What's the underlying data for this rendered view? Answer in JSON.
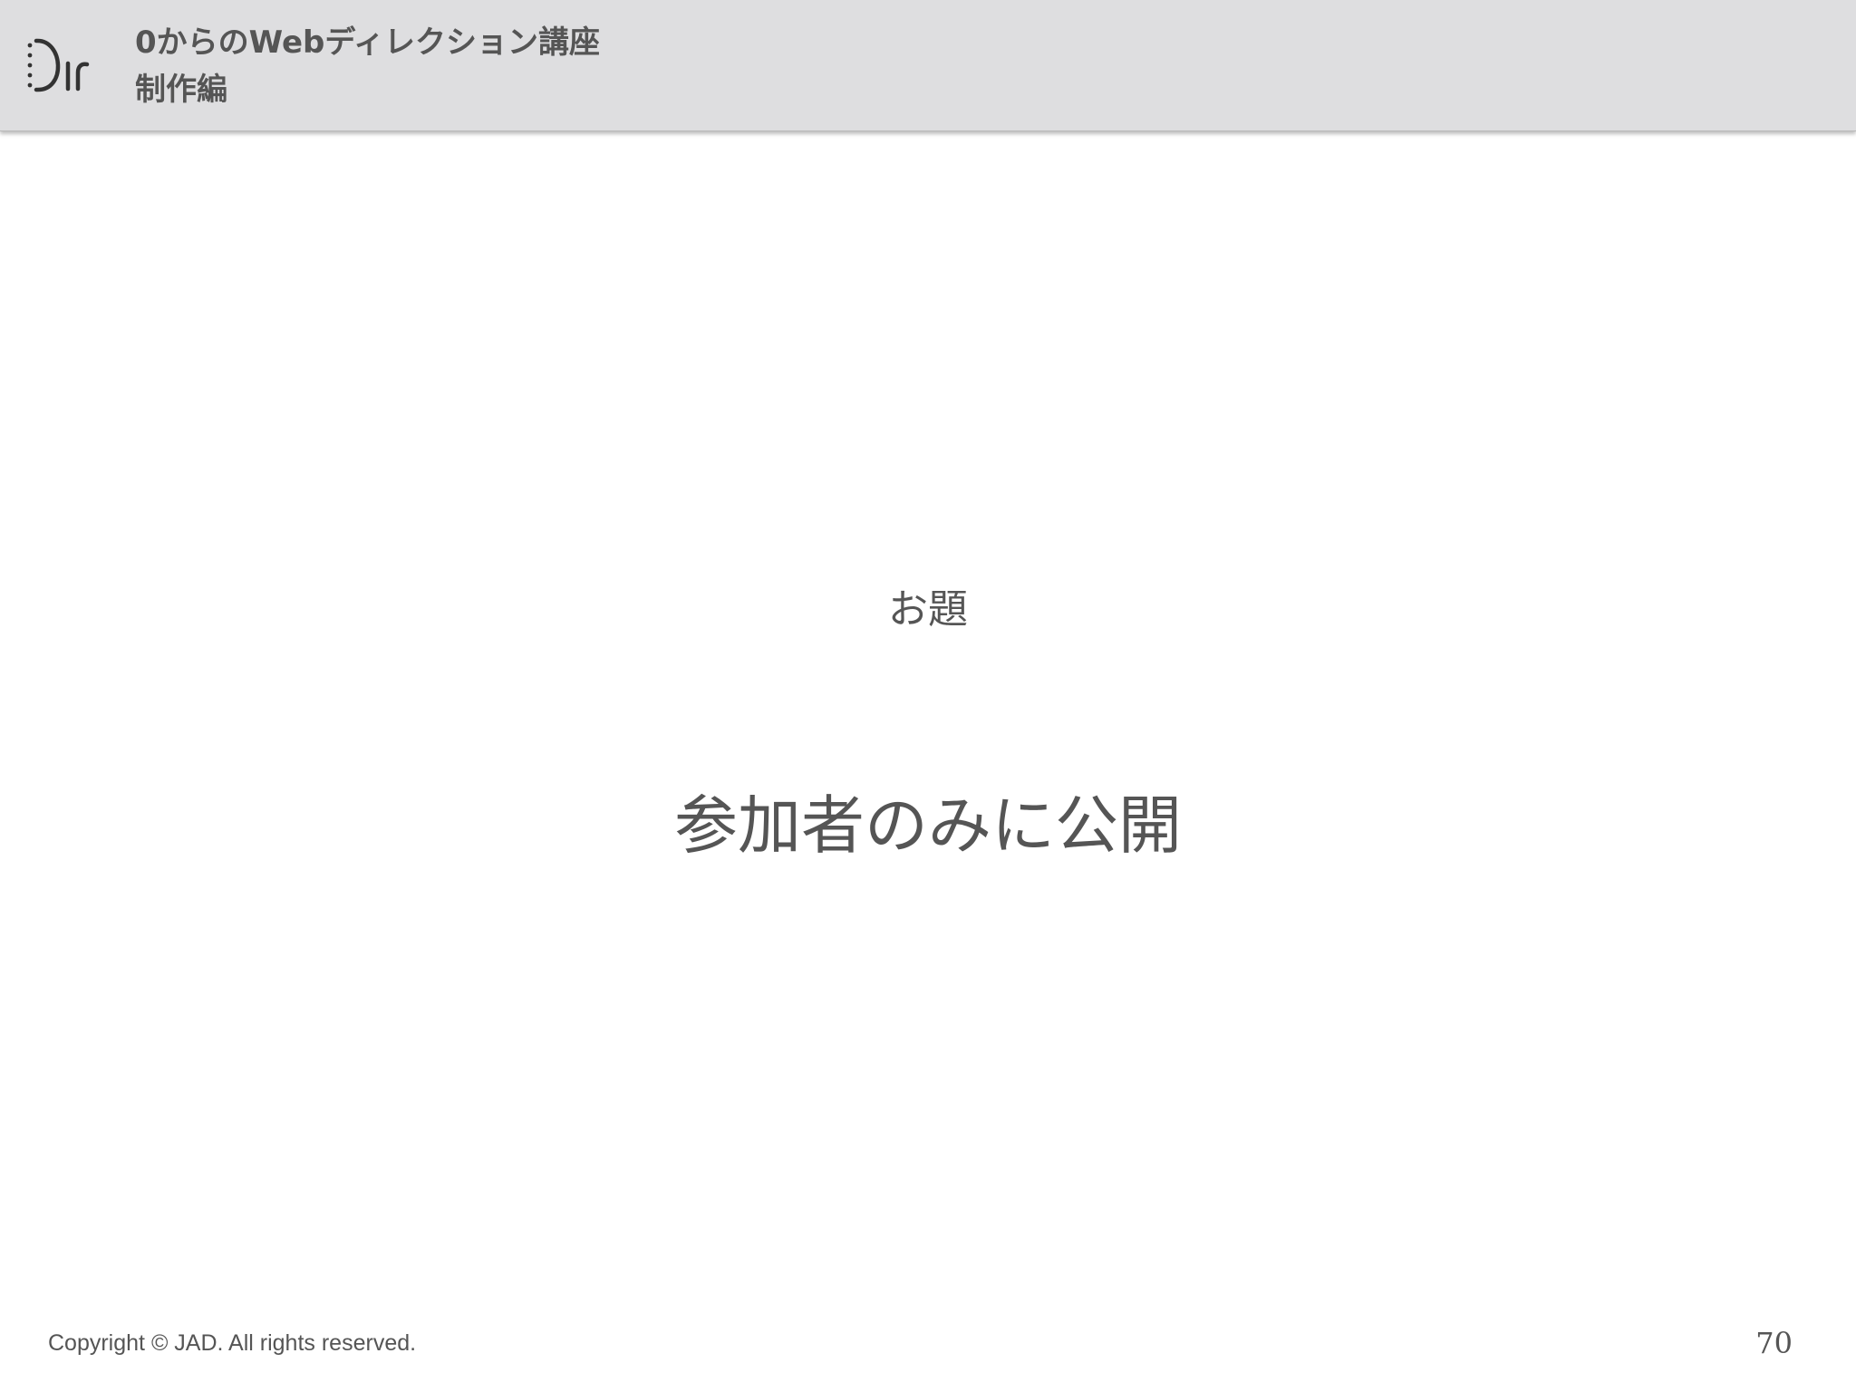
{
  "header": {
    "logo_icon": "dir-logo-icon",
    "title": "0からのWebディレクション講座",
    "subtitle": "制作編"
  },
  "slide": {
    "topic_label": "お題",
    "topic_value": "参加者のみに公開"
  },
  "footer": {
    "copyright": "Copyright © JAD. All rights reserved.",
    "page_number": "70"
  },
  "colors": {
    "header_bg": "#dedee0",
    "text": "#555555",
    "background": "#ffffff"
  }
}
